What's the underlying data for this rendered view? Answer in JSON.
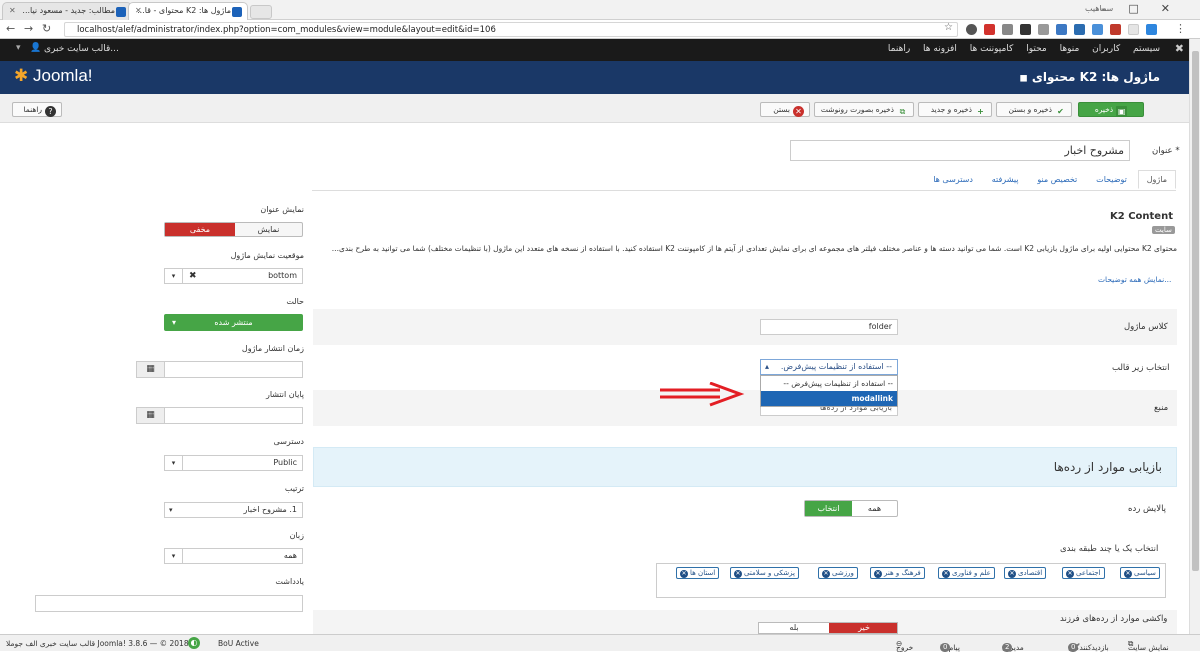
{
  "browser": {
    "tabs": [
      {
        "title": "مطالب: جدید - مسعود نیا..."
      },
      {
        "title": "ماژول ها: K2 محتوای - قا..."
      }
    ],
    "url": "localhost/alef/administrator/index.php?option=com_modules&view=module&layout=edit&id=106",
    "profile": "سماهیب"
  },
  "admin_menu": {
    "site_label": "قالب سایت خبری...",
    "items": [
      "سیستم",
      "کاربران",
      "منوها",
      "محتوا",
      "کامپوننت ها",
      "افزونه ها",
      "راهنما"
    ]
  },
  "header": {
    "logo": "Joomla!",
    "title": "ماژول ها: K2 محتوای"
  },
  "toolbar": {
    "save": "ذخیره",
    "save_close": "ذخیره و بستن",
    "save_new": "ذخیره و جدید",
    "save_copy": "ذخیره بصورت رونوشت",
    "close": "بستن",
    "help": "راهنما"
  },
  "form": {
    "title_label": "عنوان *",
    "title_value": "مشروح اخبار",
    "tabs": [
      "ماژول",
      "توضیحات",
      "تخصیص منو",
      "پیشرفته",
      "دسترسی ها"
    ],
    "module_name": "K2 Content",
    "site_badge": "سایت",
    "description": "محتوای K2 محتوایی اولیه برای ماژول بازیابی K2 است. شما می توانید دسته ها و عناصر مختلف فیلتر های مجموعه ای برای نمایش تعدادی از آیتم ها از کامپوننت K2 استفاده کنید. با استفاده از نسخه های متعدد این ماژول (با تنظیمات مختلف) شما می توانید به طرح بندی...",
    "show_all_desc": "نمایش همه توضیحات...",
    "module_class_label": "کلاس ماژول",
    "module_class_value": "folder",
    "sub_template_label": "انتخاب زیر قالب",
    "sub_template_value": "-- استفاده از تنظیمات پیش‌فرض.",
    "dropdown_options": [
      "-- استفاده از تنظیمات پیش‌فرض --",
      "modallink"
    ],
    "source_label": "منبع",
    "source_value": "بازیابی موارد از رده‌ها",
    "section_header": "بازیابی موارد از رده‌ها",
    "filter_label": "پالایش رده",
    "filter_all": "همه",
    "filter_select": "انتخاب",
    "categories_label": "انتخاب یک یا چند طبقه بندی",
    "categories": [
      "سیاسی",
      "اجتماعی",
      "اقتصادی",
      "علم و فناوری",
      "فرهنگ و هنر",
      "ورزشی",
      "پزشکی و سلامتی",
      "استان ها"
    ],
    "child_label": "واکشی موارد از رده‌های فرزند",
    "child_no": "خیر",
    "child_yes": "بله"
  },
  "sidebar": {
    "show_title_label": "نمایش عنوان",
    "show": "نمایش",
    "hide": "مخفی",
    "position_label": "موقعیت نمایش ماژول",
    "position_value": "bottom",
    "status_label": "حالت",
    "status_value": "منتشر شده",
    "publish_up_label": "زمان انتشار ماژول",
    "publish_down_label": "پایان انتشار",
    "access_label": "دسترسی",
    "access_value": "Public",
    "ordering_label": "ترتیب",
    "ordering_value": "1. مشروح اخبار",
    "language_label": "زبان",
    "language_value": "همه",
    "note_label": "یادداشت"
  },
  "statusbar": {
    "view_site": "نمایش سایت",
    "visitors": "بازدیدکنندگان",
    "visitors_count": "0",
    "admins": "مدیران",
    "admins_count": "2",
    "messages": "پیام ها",
    "messages_count": "0",
    "logout": "خروج",
    "bou": "BoU Active",
    "footer": "قالب سایت خبری الف جوملا Joomla! 3.8.6 — © 2018"
  },
  "colors": {
    "header": "#1a3867",
    "accent_red": "#c9302c",
    "green": "#46a546",
    "arrow": "#e31e24"
  }
}
